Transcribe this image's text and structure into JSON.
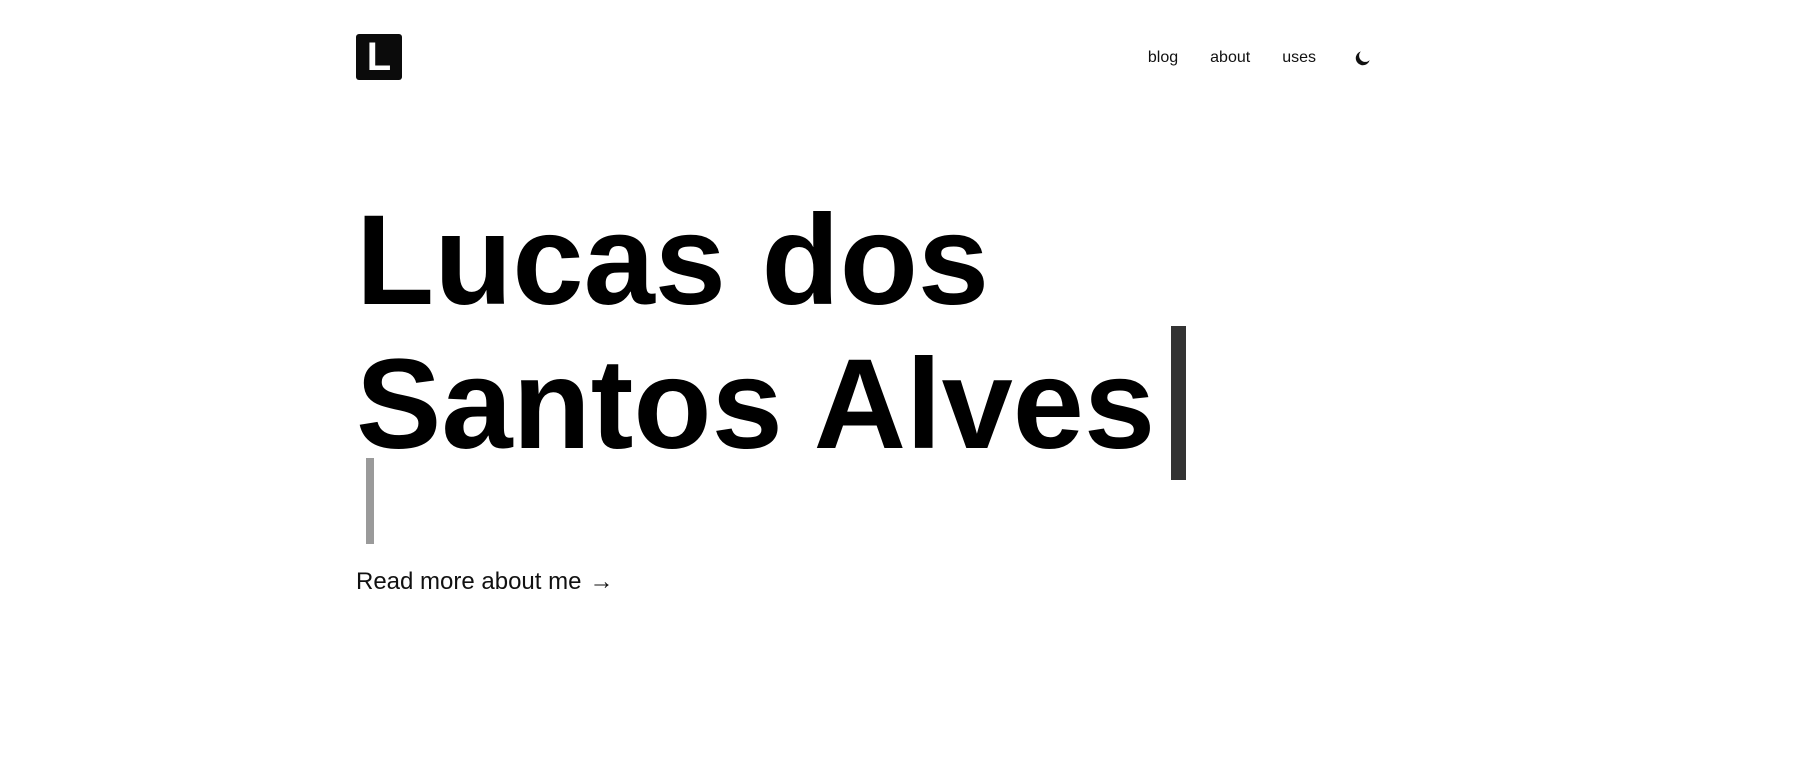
{
  "header": {
    "logo_letter": "L",
    "nav": {
      "blog": "blog",
      "about": "about",
      "uses": "uses"
    },
    "theme_toggle_icon": "moon-icon"
  },
  "hero": {
    "name_line1": "Lucas dos",
    "name_line2": "Santos Alves",
    "read_more_label": "Read more about me",
    "read_more_arrow": "→"
  },
  "colors": {
    "background": "#ffffff",
    "text": "#000000",
    "cursor_primary": "#333333",
    "cursor_secondary": "#9a9a9a"
  }
}
